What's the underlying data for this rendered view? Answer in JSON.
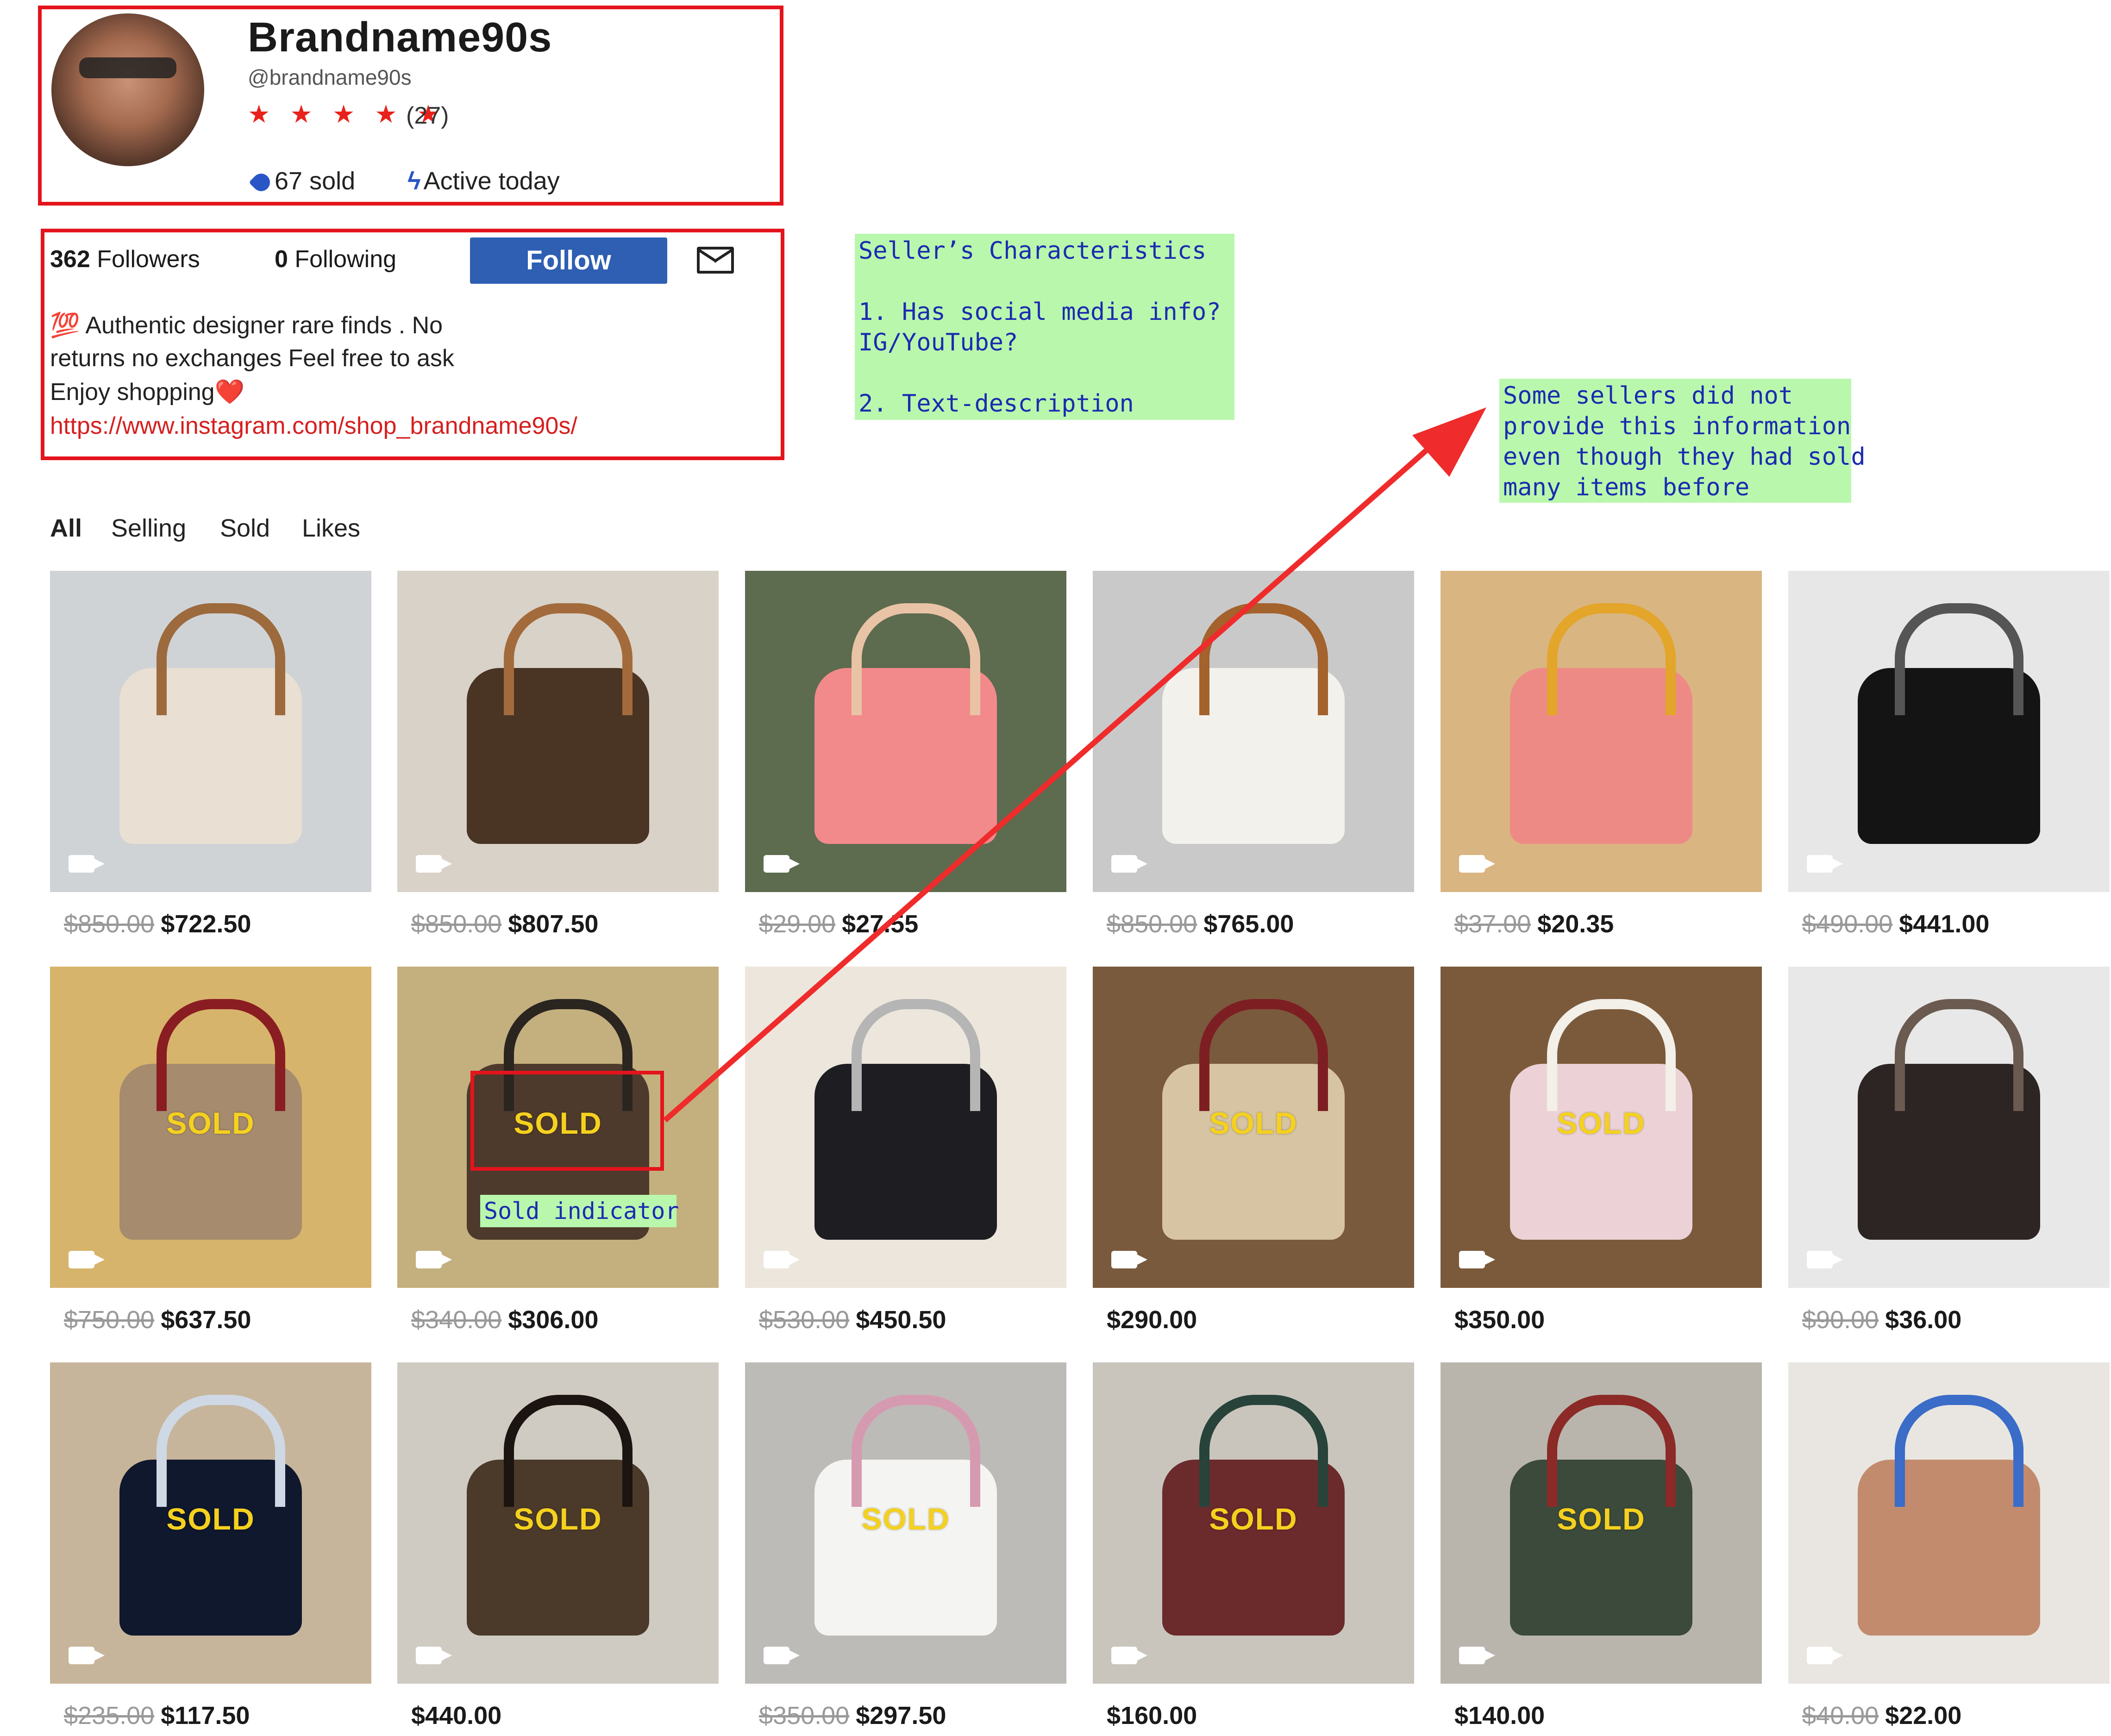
{
  "profile": {
    "name": "Brandname90s",
    "handle": "@brandname90s",
    "stars": "★ ★ ★ ★ ★",
    "review_count": "(27)",
    "sold": "67 sold",
    "active": "Active today",
    "followers_count": "362",
    "followers_label": "Followers",
    "following_count": "0",
    "following_label": "Following",
    "follow_label": "Follow",
    "bio_lines": [
      "💯 Authentic designer rare finds . No",
      "returns no exchanges  Feel free to ask",
      "Enjoy shopping❤️"
    ],
    "bio_link": "https://www.instagram.com/shop_brandname90s/"
  },
  "annotations": {
    "seller_characteristics": "Seller’s Characteristics\n\n1. Has social media info?\nIG/YouTube?\n\n2. Text-description",
    "some_sellers": "Some sellers did not\nprovide this information\neven though they had sold\nmany items before",
    "sold_indicator": "Sold indicator"
  },
  "tabs": [
    "All",
    "Selling",
    "Sold",
    "Likes"
  ],
  "sold_text": "SOLD",
  "listings": [
    {
      "old": "$850.00",
      "price": "$722.50",
      "sold": false,
      "bg": "#cfd3d6",
      "item": "#e9dfd2",
      "accent": "#9c6a3d"
    },
    {
      "old": "$850.00",
      "price": "$807.50",
      "sold": false,
      "bg": "#d8d2c8",
      "item": "#4a3424",
      "accent": "#a36b3b"
    },
    {
      "old": "$29.00",
      "price": "$27.55",
      "sold": false,
      "bg": "#5d6b4f",
      "item": "#f28a8c",
      "accent": "#e9c3a5"
    },
    {
      "old": "$850.00",
      "price": "$765.00",
      "sold": false,
      "bg": "#c9c9c9",
      "item": "#f3f1ec",
      "accent": "#a4622c"
    },
    {
      "old": "$37.00",
      "price": "$20.35",
      "sold": false,
      "bg": "#d9b582",
      "item": "#ee8a86",
      "accent": "#e3a52a"
    },
    {
      "old": "$490.00",
      "price": "$441.00",
      "sold": false,
      "bg": "#e7e7e7",
      "item": "#141414",
      "accent": "#555555"
    },
    {
      "old": "$750.00",
      "price": "$637.50",
      "sold": true,
      "bg": "#d7b46b",
      "item": "#a68b6e",
      "accent": "#8a1d22"
    },
    {
      "old": "$340.00",
      "price": "$306.00",
      "sold": true,
      "bg": "#c4b07e",
      "item": "#4d3a2c",
      "accent": "#2b2520"
    },
    {
      "old": "$530.00",
      "price": "$450.50",
      "sold": false,
      "bg": "#ece6dc",
      "item": "#1d1d22",
      "accent": "#b5b5b5"
    },
    {
      "old": "",
      "price": "$290.00",
      "sold": true,
      "bg": "#7a5a3c",
      "item": "#d7c4a3",
      "accent": "#7d1f22"
    },
    {
      "old": "",
      "price": "$350.00",
      "sold": true,
      "bg": "#7b5a3b",
      "item": "#ecd2d6",
      "accent": "#f3efe9"
    },
    {
      "old": "$90.00",
      "price": "$36.00",
      "sold": false,
      "bg": "#e8e8e8",
      "item": "#2d2424",
      "accent": "#6a5a50"
    },
    {
      "old": "$235.00",
      "price": "$117.50",
      "sold": true,
      "bg": "#c7b59b",
      "item": "#10182e",
      "accent": "#cfd9e6"
    },
    {
      "old": "",
      "price": "$440.00",
      "sold": true,
      "bg": "#cfcbc3",
      "item": "#4b3a2a",
      "accent": "#1b1410"
    },
    {
      "old": "$350.00",
      "price": "$297.50",
      "sold": true,
      "bg": "#bdbbb7",
      "item": "#f4f4f2",
      "accent": "#d69ab0"
    },
    {
      "old": "",
      "price": "$160.00",
      "sold": true,
      "bg": "#c9c5bd",
      "item": "#6b2a2c",
      "accent": "#27433a"
    },
    {
      "old": "",
      "price": "$140.00",
      "sold": true,
      "bg": "#b9b5ad",
      "item": "#3b4a3a",
      "accent": "#8b2a26"
    },
    {
      "old": "$40.00",
      "price": "$22.00",
      "sold": false,
      "bg": "#e9e6e1",
      "item": "#c28b6d",
      "accent": "#3a6cc8"
    }
  ]
}
